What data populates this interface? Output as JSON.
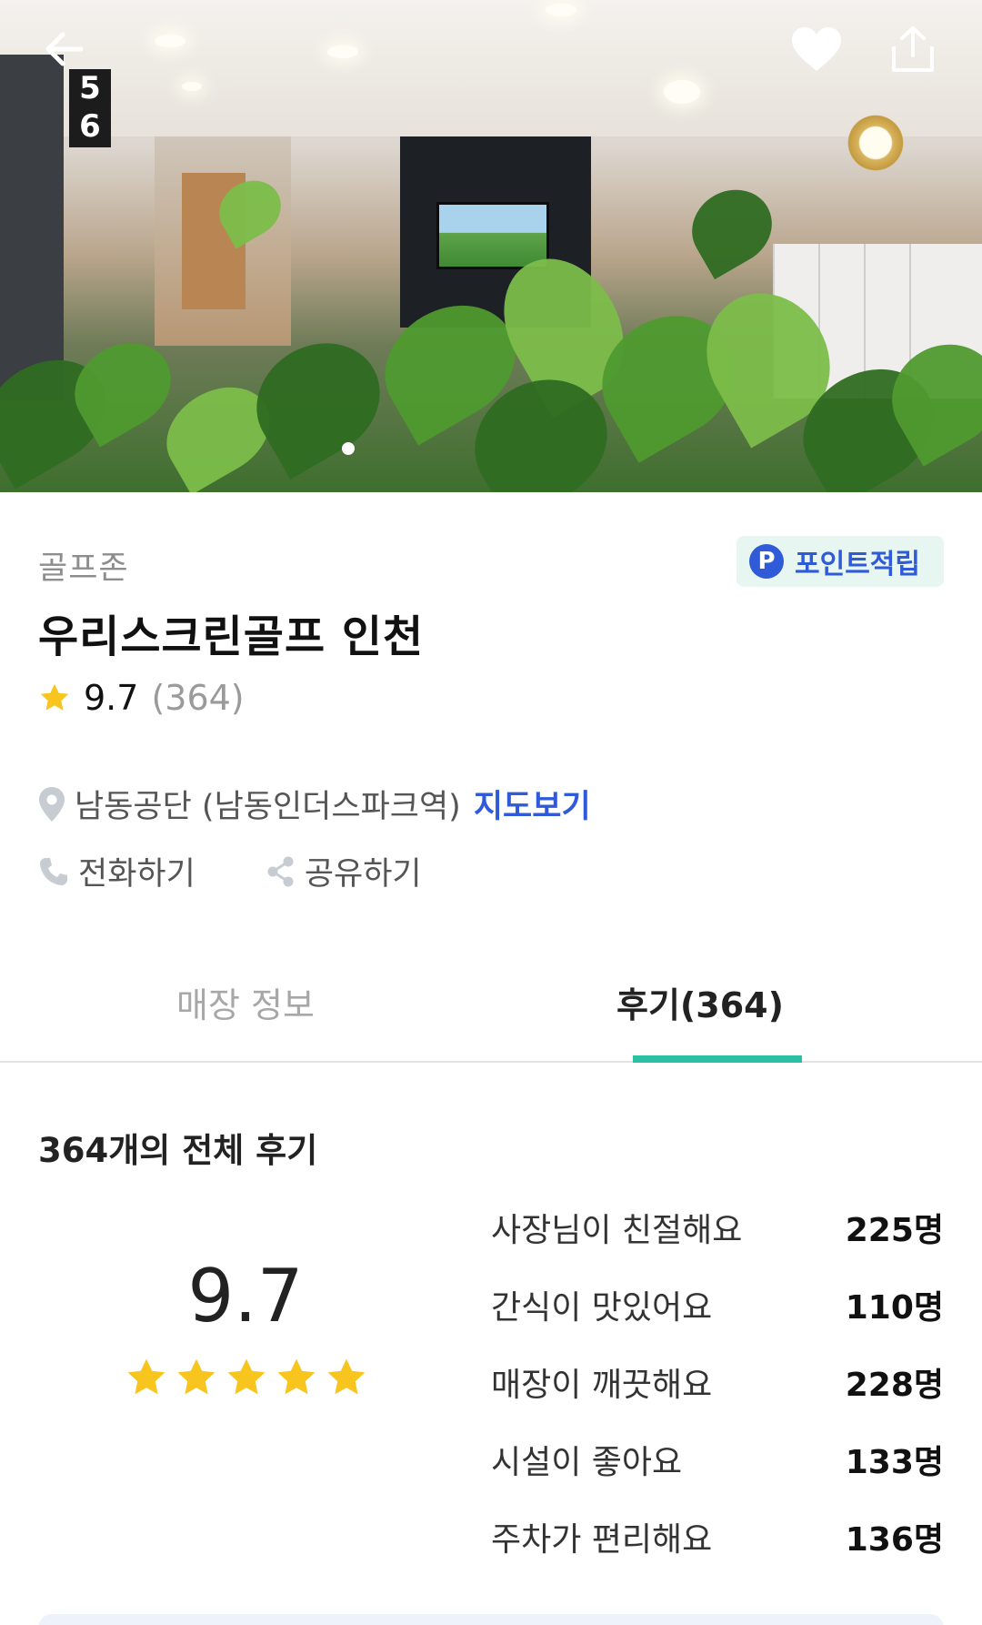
{
  "hero": {
    "sign_numbers": [
      "5",
      "6"
    ],
    "image_indicator_count": 1,
    "icons": {
      "back": "arrow-left-icon",
      "favorite": "heart-icon",
      "share": "share-upload-icon"
    }
  },
  "store": {
    "category": "골프존",
    "points_badge": {
      "icon_letter": "P",
      "label": "포인트적립",
      "color": "#2f5bd8",
      "background": "#e8f6f1"
    },
    "name": "우리스크린골프 인천",
    "rating": {
      "score": "9.7",
      "count": "(364)",
      "star_color": "#f7c51e"
    },
    "location": {
      "text": "남동공단 (남동인더스파크역)",
      "map_link": "지도보기",
      "icon": "map-pin-icon"
    },
    "actions": [
      {
        "label": "전화하기",
        "icon": "phone-icon"
      },
      {
        "label": "공유하기",
        "icon": "share-icon"
      }
    ]
  },
  "tabs": [
    {
      "label": "매장 정보",
      "active": false
    },
    {
      "label": "후기(364)",
      "active": true
    }
  ],
  "accent_color": "#2bbfa3",
  "reviews": {
    "title": "364개의 전체 후기",
    "average": "9.7",
    "stars": 5,
    "keywords": [
      {
        "label": "사장님이 친절해요",
        "count": "225명"
      },
      {
        "label": "간식이 맛있어요",
        "count": "110명"
      },
      {
        "label": "매장이 깨끗해요",
        "count": "228명"
      },
      {
        "label": "시설이 좋아요",
        "count": "133명"
      },
      {
        "label": "주차가 편리해요",
        "count": "136명"
      }
    ]
  }
}
